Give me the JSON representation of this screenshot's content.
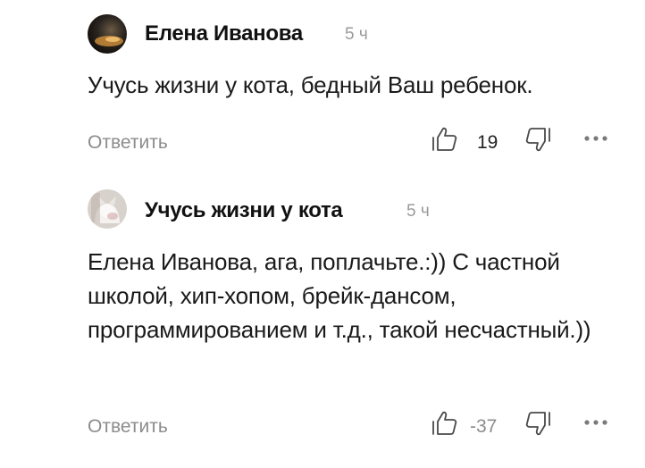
{
  "comments": [
    {
      "author": "Елена Иванова",
      "time": "5 ч",
      "text": "Учусь жизни у кота, бедный Ваш ребенок.",
      "reply_label": "Ответить",
      "likes": "19",
      "avatar_icon": "moon-landscape-avatar",
      "like_icon": "thumbs-up-icon",
      "dislike_icon": "thumbs-down-icon",
      "more_icon": "more-dots-icon"
    },
    {
      "author": "Учусь жизни у кота",
      "time": "5 ч",
      "text": "Елена Иванова, ага, поплачьте.:)) С частной школой, хип-хопом, брейк-дансом, программированием и т.д., такой несчастный.))",
      "reply_label": "Ответить",
      "likes": "-37",
      "avatar_icon": "cat-avatar",
      "like_icon": "thumbs-up-icon",
      "dislike_icon": "thumbs-down-icon",
      "more_icon": "more-dots-icon"
    }
  ],
  "colors": {
    "author": "#111111",
    "time": "#9a9a9a",
    "reply": "#8c8c8c",
    "icon": "#4a4a4a"
  }
}
